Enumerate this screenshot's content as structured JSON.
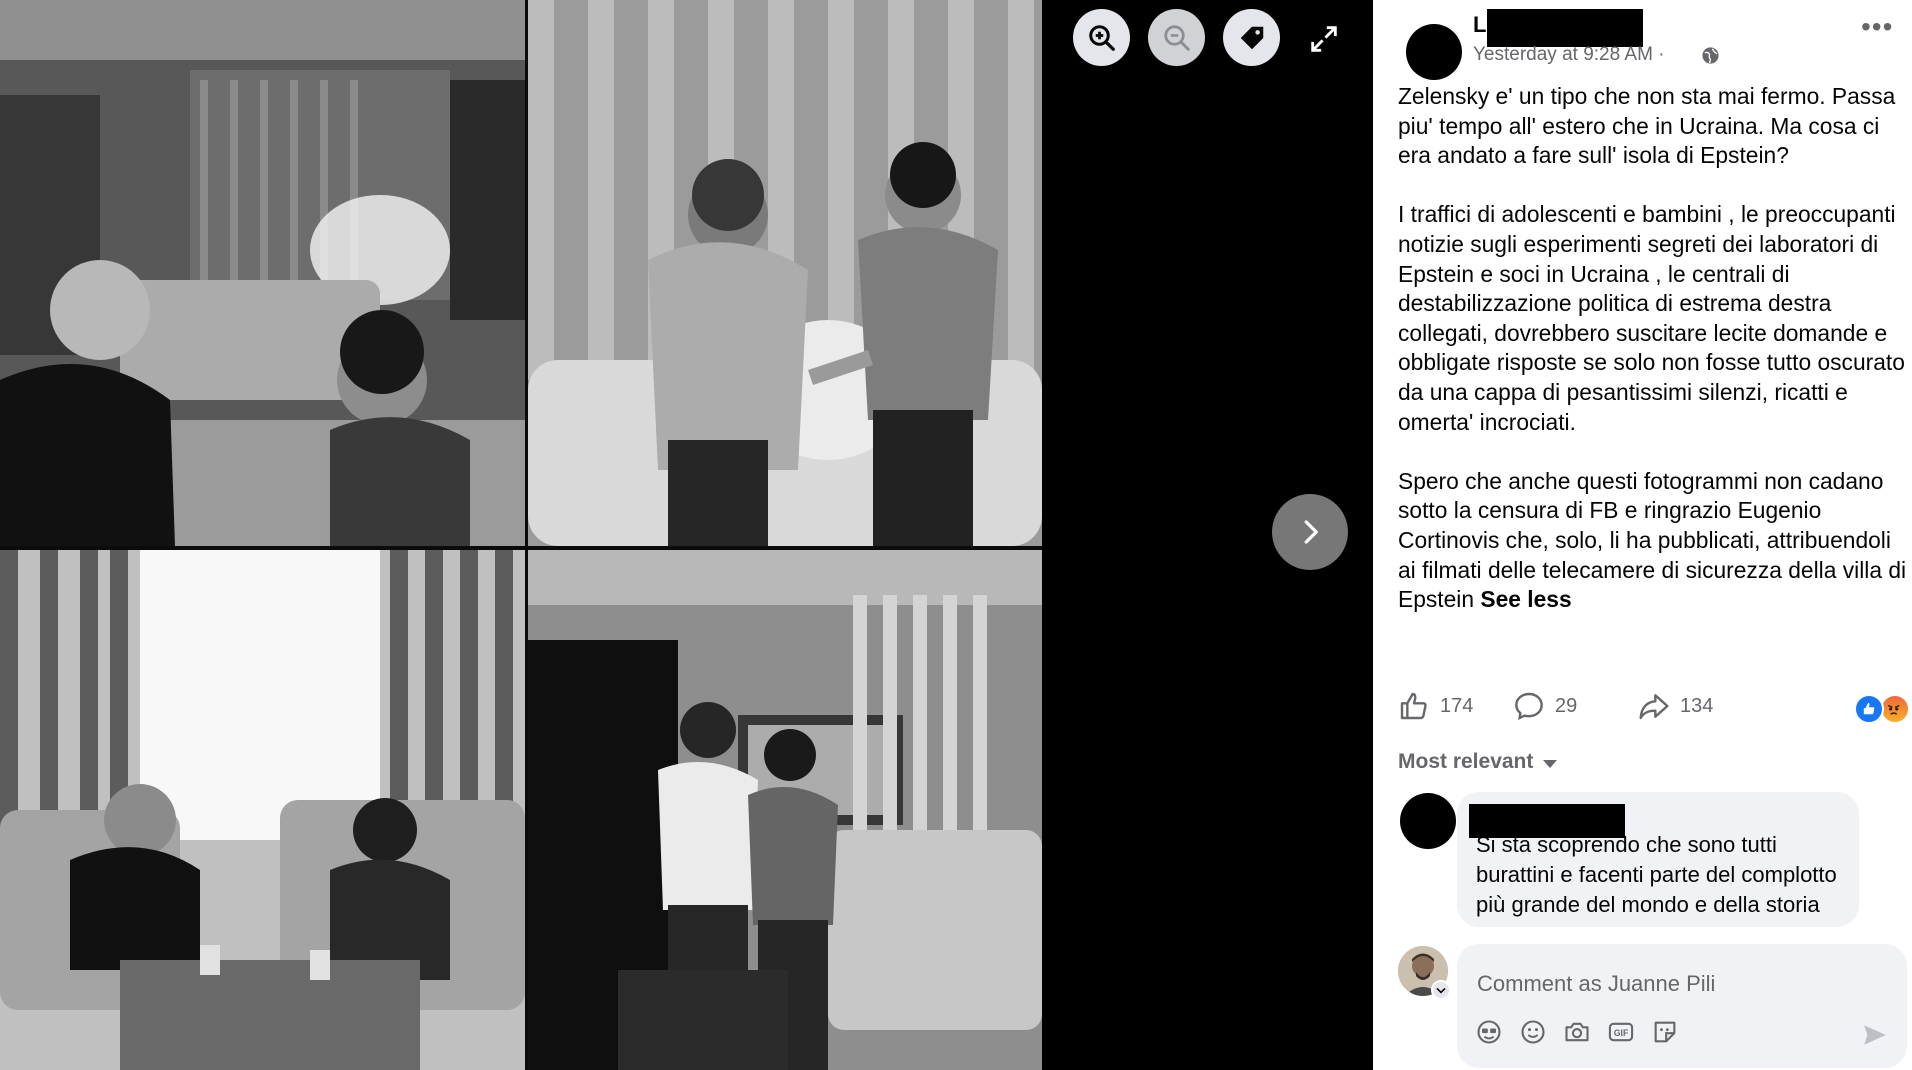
{
  "viewer": {
    "controls": [
      "zoom-in",
      "zoom-out",
      "tag",
      "fullscreen",
      "next"
    ],
    "icons": {
      "zoom_in": "zoom-in-icon",
      "zoom_out": "zoom-out-icon",
      "tag": "tag-icon",
      "fullscreen": "expand-icon",
      "next": "chevron-right-icon"
    }
  },
  "post": {
    "author_visible": "Li",
    "time": "Yesterday at 9:28 AM ·",
    "privacy_icon": "globe-icon",
    "paragraphs": [
      "Zelensky e' un tipo che non sta mai fermo. Passa piu' tempo all' estero che in Ucraina. Ma cosa ci era andato a fare sull' isola di Epstein?",
      "I traffici di adolescenti e bambini , le preoccupanti notizie sugli esperimenti segreti dei laboratori di Epstein e soci in Ucraina , le centrali di destabilizzazione politica di estrema destra collegati, dovrebbero suscitare lecite domande e obbligate risposte se solo non fosse tutto oscurato da una cappa di pesantissimi silenzi, ricatti e omerta' incrociati.",
      "Spero che anche questi fotogrammi non cadano sotto la censura di FB e ringrazio Eugenio Cortinovis che, solo, li ha pubblicati, attribuendoli ai filmati delle telecamere di sicurezza della villa di Epstein"
    ],
    "see_less": "See less"
  },
  "actions": {
    "likes": "174",
    "comments": "29",
    "shares": "134",
    "reaction_icons": [
      "like-reaction",
      "angry-reaction"
    ]
  },
  "comments": {
    "sort_label": "Most relevant",
    "top_comment_text": "Si sta scoprendo che sono tutti burattini e facenti parte del complotto più grande del mondo e della storia"
  },
  "composer": {
    "placeholder": "Comment as Juanne Pili",
    "tools": [
      "avatar-sticker-icon",
      "emoji-icon",
      "camera-icon",
      "gif-icon",
      "sticker-icon"
    ]
  },
  "colors": {
    "secondary_text": "#65676b",
    "like_blue": "#1877f2",
    "bubble_bg": "#f0f2f5",
    "button_bg": "#e4e6eb"
  }
}
